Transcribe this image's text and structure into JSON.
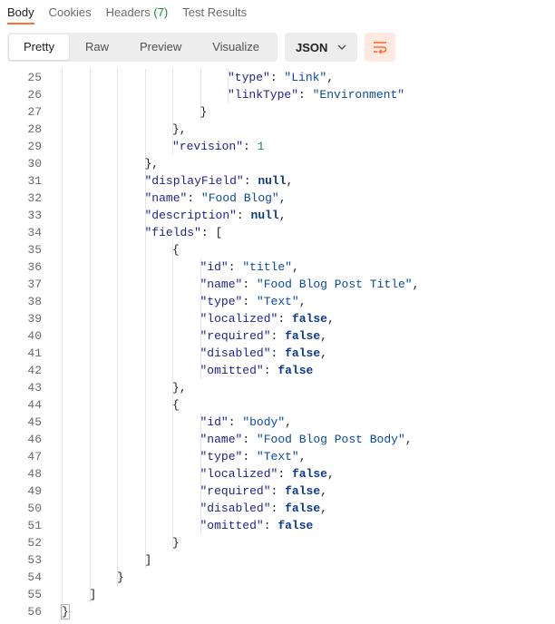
{
  "tabs": [
    {
      "label": "Body",
      "active": true
    },
    {
      "label": "Cookies",
      "active": false
    },
    {
      "label": "Headers",
      "count": "(7)",
      "active": false
    },
    {
      "label": "Test Results",
      "active": false
    }
  ],
  "view_modes": [
    "Pretty",
    "Raw",
    "Preview",
    "Visualize"
  ],
  "active_view": "Pretty",
  "format": {
    "selected": "JSON",
    "icon": "chevron-down-icon"
  },
  "wrap_icon": "wrap-lines-icon",
  "accent_color": "#ff6c37",
  "code_lines": [
    {
      "n": "25",
      "i": 8,
      "t": [
        [
          "k",
          "\"type\""
        ],
        [
          "p",
          ": "
        ],
        [
          "s",
          "\"Link\""
        ],
        [
          "p",
          ","
        ]
      ]
    },
    {
      "n": "26",
      "i": 8,
      "t": [
        [
          "k",
          "\"linkType\""
        ],
        [
          "p",
          ": "
        ],
        [
          "s",
          "\"Environment\""
        ]
      ]
    },
    {
      "n": "27",
      "i": 7,
      "t": [
        [
          "p",
          "}"
        ]
      ]
    },
    {
      "n": "28",
      "i": 6,
      "t": [
        [
          "p",
          "},"
        ]
      ]
    },
    {
      "n": "29",
      "i": 6,
      "t": [
        [
          "k",
          "\"revision\""
        ],
        [
          "p",
          ": "
        ],
        [
          "n",
          "1"
        ]
      ]
    },
    {
      "n": "30",
      "i": 5,
      "t": [
        [
          "p",
          "},"
        ]
      ]
    },
    {
      "n": "31",
      "i": 5,
      "t": [
        [
          "k",
          "\"displayField\""
        ],
        [
          "p",
          ": "
        ],
        [
          "b",
          "null"
        ],
        [
          "p",
          ","
        ]
      ]
    },
    {
      "n": "32",
      "i": 5,
      "t": [
        [
          "k",
          "\"name\""
        ],
        [
          "p",
          ": "
        ],
        [
          "s",
          "\"Food Blog\""
        ],
        [
          "p",
          ","
        ]
      ]
    },
    {
      "n": "33",
      "i": 5,
      "t": [
        [
          "k",
          "\"description\""
        ],
        [
          "p",
          ": "
        ],
        [
          "b",
          "null"
        ],
        [
          "p",
          ","
        ]
      ]
    },
    {
      "n": "34",
      "i": 5,
      "t": [
        [
          "k",
          "\"fields\""
        ],
        [
          "p",
          ": ["
        ]
      ]
    },
    {
      "n": "35",
      "i": 6,
      "t": [
        [
          "p",
          "{"
        ]
      ]
    },
    {
      "n": "36",
      "i": 7,
      "t": [
        [
          "k",
          "\"id\""
        ],
        [
          "p",
          ": "
        ],
        [
          "s",
          "\"title\""
        ],
        [
          "p",
          ","
        ]
      ]
    },
    {
      "n": "37",
      "i": 7,
      "t": [
        [
          "k",
          "\"name\""
        ],
        [
          "p",
          ": "
        ],
        [
          "s",
          "\"Food Blog Post Title\""
        ],
        [
          "p",
          ","
        ]
      ]
    },
    {
      "n": "38",
      "i": 7,
      "t": [
        [
          "k",
          "\"type\""
        ],
        [
          "p",
          ": "
        ],
        [
          "s",
          "\"Text\""
        ],
        [
          "p",
          ","
        ]
      ]
    },
    {
      "n": "39",
      "i": 7,
      "t": [
        [
          "k",
          "\"localized\""
        ],
        [
          "p",
          ": "
        ],
        [
          "b",
          "false"
        ],
        [
          "p",
          ","
        ]
      ]
    },
    {
      "n": "40",
      "i": 7,
      "t": [
        [
          "k",
          "\"required\""
        ],
        [
          "p",
          ": "
        ],
        [
          "b",
          "false"
        ],
        [
          "p",
          ","
        ]
      ]
    },
    {
      "n": "41",
      "i": 7,
      "t": [
        [
          "k",
          "\"disabled\""
        ],
        [
          "p",
          ": "
        ],
        [
          "b",
          "false"
        ],
        [
          "p",
          ","
        ]
      ]
    },
    {
      "n": "42",
      "i": 7,
      "t": [
        [
          "k",
          "\"omitted\""
        ],
        [
          "p",
          ": "
        ],
        [
          "b",
          "false"
        ]
      ]
    },
    {
      "n": "43",
      "i": 6,
      "t": [
        [
          "p",
          "},"
        ]
      ]
    },
    {
      "n": "44",
      "i": 6,
      "t": [
        [
          "p",
          "{"
        ]
      ]
    },
    {
      "n": "45",
      "i": 7,
      "t": [
        [
          "k",
          "\"id\""
        ],
        [
          "p",
          ": "
        ],
        [
          "s",
          "\"body\""
        ],
        [
          "p",
          ","
        ]
      ]
    },
    {
      "n": "46",
      "i": 7,
      "t": [
        [
          "k",
          "\"name\""
        ],
        [
          "p",
          ": "
        ],
        [
          "s",
          "\"Food Blog Post Body\""
        ],
        [
          "p",
          ","
        ]
      ]
    },
    {
      "n": "47",
      "i": 7,
      "t": [
        [
          "k",
          "\"type\""
        ],
        [
          "p",
          ": "
        ],
        [
          "s",
          "\"Text\""
        ],
        [
          "p",
          ","
        ]
      ]
    },
    {
      "n": "48",
      "i": 7,
      "t": [
        [
          "k",
          "\"localized\""
        ],
        [
          "p",
          ": "
        ],
        [
          "b",
          "false"
        ],
        [
          "p",
          ","
        ]
      ]
    },
    {
      "n": "49",
      "i": 7,
      "t": [
        [
          "k",
          "\"required\""
        ],
        [
          "p",
          ": "
        ],
        [
          "b",
          "false"
        ],
        [
          "p",
          ","
        ]
      ]
    },
    {
      "n": "50",
      "i": 7,
      "t": [
        [
          "k",
          "\"disabled\""
        ],
        [
          "p",
          ": "
        ],
        [
          "b",
          "false"
        ],
        [
          "p",
          ","
        ]
      ]
    },
    {
      "n": "51",
      "i": 7,
      "t": [
        [
          "k",
          "\"omitted\""
        ],
        [
          "p",
          ": "
        ],
        [
          "b",
          "false"
        ]
      ]
    },
    {
      "n": "52",
      "i": 6,
      "t": [
        [
          "p",
          "}"
        ]
      ]
    },
    {
      "n": "53",
      "i": 5,
      "t": [
        [
          "p",
          "]"
        ]
      ]
    },
    {
      "n": "54",
      "i": 4,
      "t": [
        [
          "p",
          "}"
        ]
      ]
    },
    {
      "n": "55",
      "i": 3,
      "t": [
        [
          "p",
          "]"
        ]
      ]
    },
    {
      "n": "56",
      "i": 2,
      "t": [
        [
          "p",
          "}"
        ]
      ]
    }
  ]
}
